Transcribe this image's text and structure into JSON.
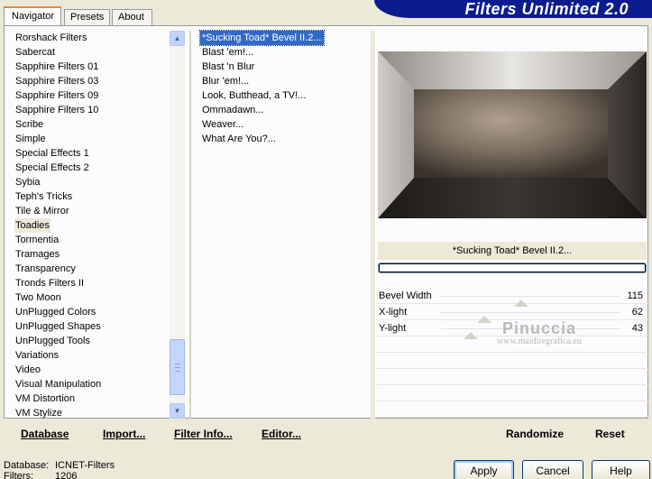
{
  "tabs": [
    {
      "label": "Navigator",
      "active": true
    },
    {
      "label": "Presets",
      "active": false
    },
    {
      "label": "About",
      "active": false
    }
  ],
  "banner": {
    "title": "Filters Unlimited 2.0"
  },
  "categories": {
    "items": [
      "Rorshack Filters",
      "Sabercat",
      "Sapphire Filters 01",
      "Sapphire Filters 03",
      "Sapphire Filters 09",
      "Sapphire Filters 10",
      "Scribe",
      "Simple",
      "Special Effects 1",
      "Special Effects 2",
      "Sybia",
      "Teph's Tricks",
      "Tile & Mirror",
      "Toadies",
      "Tormentia",
      "Tramages",
      "Transparency",
      "Tronds Filters II",
      "Two Moon",
      "UnPlugged Colors",
      "UnPlugged Shapes",
      "UnPlugged Tools",
      "Variations",
      "Video",
      "Visual Manipulation",
      "VM Distortion",
      "VM Stylize"
    ],
    "selected": "Toadies"
  },
  "filters": {
    "items": [
      "*Sucking Toad*  Bevel II.2...",
      "Blast 'em!...",
      "Blast 'n Blur",
      "Blur 'em!...",
      "Look, Butthead, a TV!...",
      "Ommadawn...",
      "Weaver...",
      "What Are You?..."
    ],
    "selected": "*Sucking Toad*  Bevel II.2..."
  },
  "preview": {
    "selected_filter_label": "*Sucking Toad*  Bevel II.2..."
  },
  "params": [
    {
      "name": "Bevel Width",
      "value": "115",
      "level": 0.451
    },
    {
      "name": "X-light",
      "value": "62",
      "level": 0.243
    },
    {
      "name": "Y-light",
      "value": "43",
      "level": 0.169
    }
  ],
  "watermark": {
    "line1": "Pinuccia",
    "line2": "www.maidiregrafica.eu"
  },
  "buttons": {
    "database": "Database",
    "import": "Import...",
    "filter_info": "Filter Info...",
    "editor": "Editor...",
    "randomize": "Randomize",
    "reset": "Reset",
    "apply": "Apply",
    "cancel": "Cancel",
    "help": "Help"
  },
  "status": {
    "database_label": "Database:",
    "database_value": "ICNET-Filters",
    "filters_label": "Filters:",
    "filters_value": "1206"
  },
  "colors": {
    "banner": "#0c1c8e",
    "selection": "#316ac5",
    "window": "#ece9d8"
  }
}
